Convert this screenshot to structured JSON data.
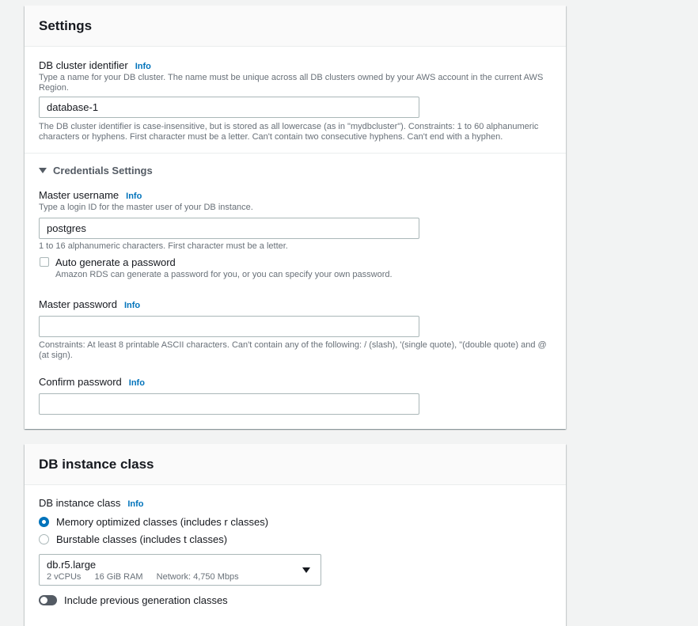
{
  "settings": {
    "title": "Settings",
    "cluster_id": {
      "label": "DB cluster identifier",
      "info": "Info",
      "desc": "Type a name for your DB cluster. The name must be unique across all DB clusters owned by your AWS account in the current AWS Region.",
      "value": "database-1",
      "constraints": "The DB cluster identifier is case-insensitive, but is stored as all lowercase (as in \"mydbcluster\"). Constraints: 1 to 60 alphanumeric characters or hyphens. First character must be a letter. Can't contain two consecutive hyphens. Can't end with a hyphen."
    },
    "credentials": {
      "title": "Credentials Settings",
      "expanded": true,
      "username": {
        "label": "Master username",
        "info": "Info",
        "desc": "Type a login ID for the master user of your DB instance.",
        "value": "postgres",
        "constraints": "1 to 16 alphanumeric characters. First character must be a letter."
      },
      "auto_generate": {
        "label": "Auto generate a password",
        "desc": "Amazon RDS can generate a password for you, or you can specify your own password.",
        "checked": false
      },
      "password": {
        "label": "Master password",
        "info": "Info",
        "value": "",
        "constraints": "Constraints: At least 8 printable ASCII characters. Can't contain any of the following: / (slash), '(single quote), \"(double quote) and @ (at sign)."
      },
      "confirm": {
        "label": "Confirm password",
        "info": "Info",
        "value": ""
      }
    }
  },
  "instance_class": {
    "title": "DB instance class",
    "label": "DB instance class",
    "info": "Info",
    "options": [
      {
        "label": "Memory optimized classes (includes r classes)",
        "selected": true
      },
      {
        "label": "Burstable classes (includes t classes)",
        "selected": false
      }
    ],
    "select": {
      "value": "db.r5.large",
      "vcpus": "2 vCPUs",
      "ram": "16 GiB RAM",
      "network": "Network: 4,750 Mbps"
    },
    "toggle": {
      "label": "Include previous generation classes",
      "on": false
    }
  },
  "colors": {
    "accent": "#0073bb",
    "text": "#16191f",
    "muted": "#687078",
    "border": "#aab7b8"
  },
  "icons": [
    "caret-down-icon",
    "select-caret-icon"
  ]
}
